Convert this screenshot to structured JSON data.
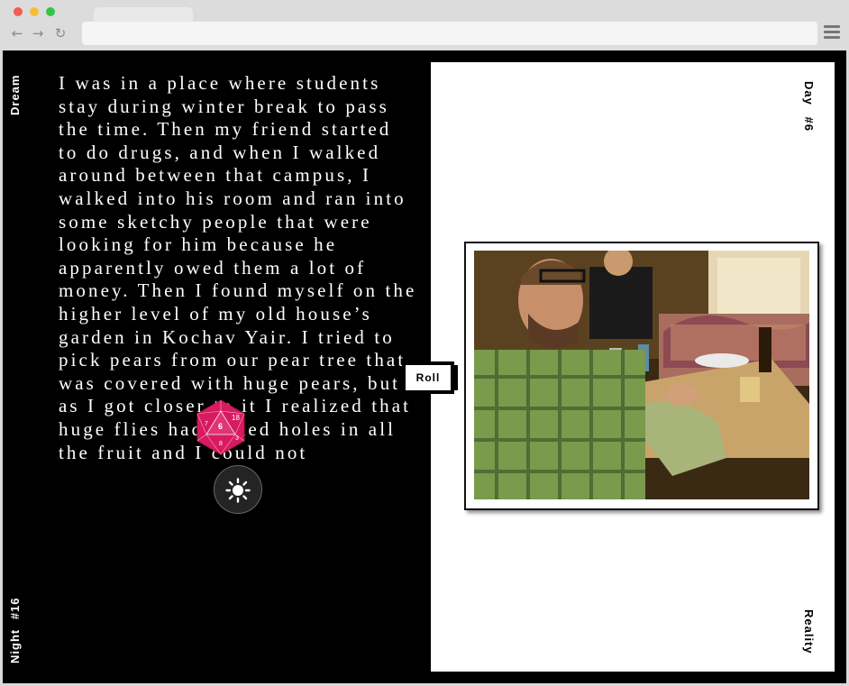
{
  "browser": {
    "address": "",
    "nav": {
      "back": "←",
      "forward": "→",
      "reload": "↻"
    }
  },
  "page": {
    "left_label": "Dream",
    "left_bottom_label": "Night #16",
    "right_top_label": "Day #6",
    "right_bottom_label": "Reality",
    "dream_text": "I was in a place where students stay during winter break to pass the time. Then my friend started to do drugs, and when I walked around between that campus, I walked into his room and ran into some sketchy people that were looking for him because he apparently owed them a lot of money. Then I found myself on the higher level of my old house’s garden in Kochav Yair. I tried to pick pears from our pear tree that was covered with huge pears, but as I got closer to it I realized that huge flies had poked holes in all the fruit and I could not",
    "roll_label": "Roll",
    "dice_faces": [
      "18",
      "6",
      "7",
      "8",
      "3"
    ],
    "icons": {
      "dice": "d20-dice-icon",
      "theme": "sun-icon",
      "menu": "hamburger-menu-icon"
    },
    "colors": {
      "dice": "#d81b60",
      "background": "#000000",
      "panel": "#ffffff"
    }
  }
}
